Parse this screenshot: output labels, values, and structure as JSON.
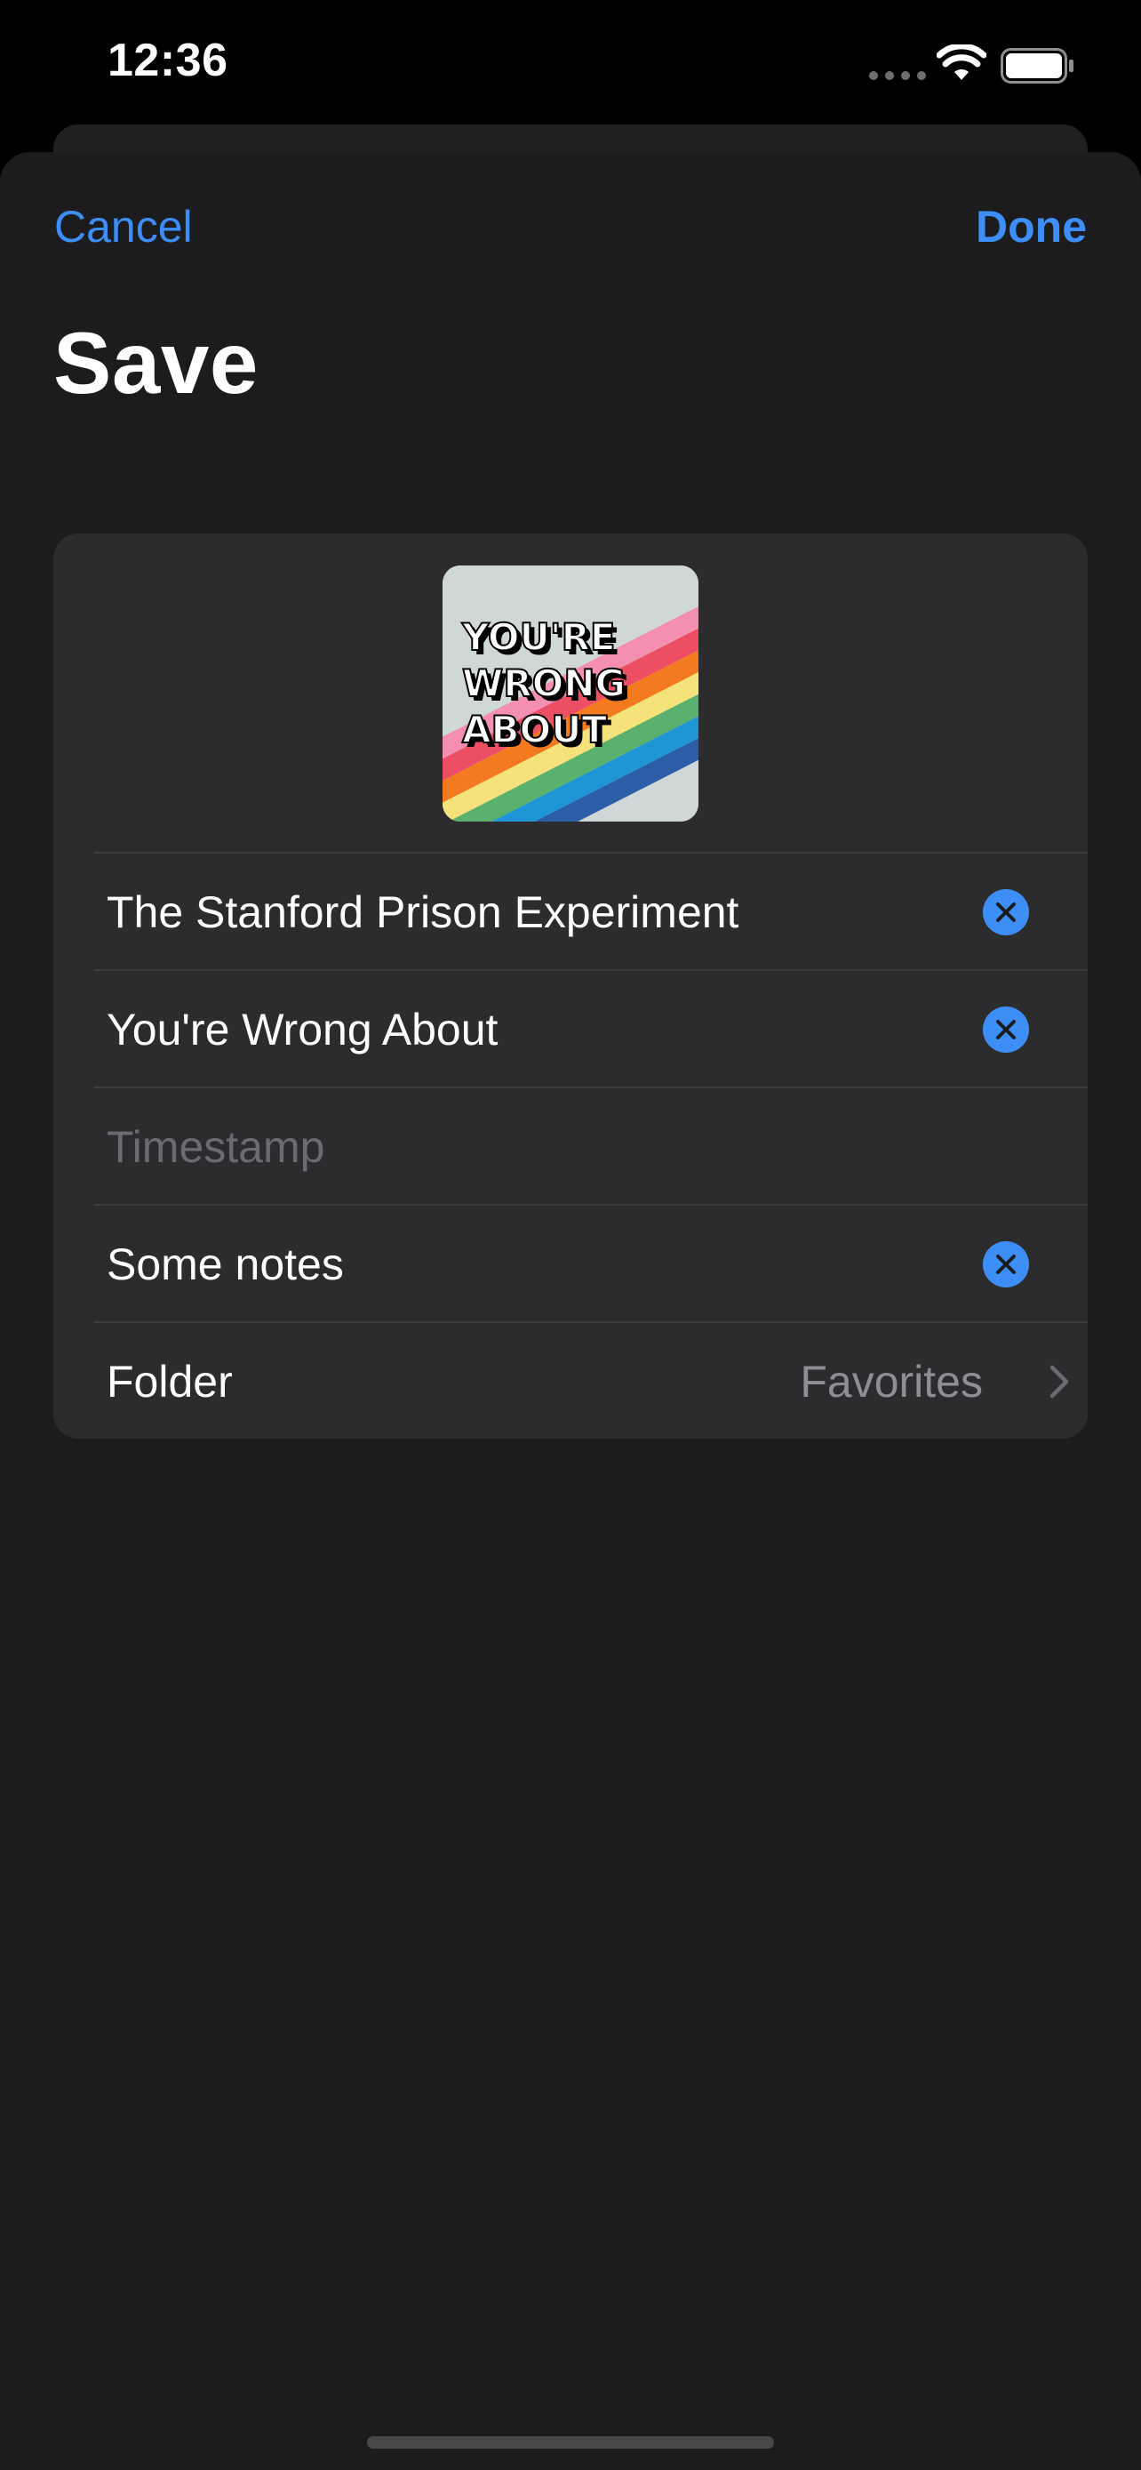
{
  "status_bar": {
    "time": "12:36",
    "signal_icon": "cellular-signal-icon",
    "wifi_icon": "wifi-icon",
    "battery_icon": "battery-icon"
  },
  "nav": {
    "cancel_label": "Cancel",
    "done_label": "Done",
    "title": "Save"
  },
  "artwork": {
    "icon": "podcast-artwork",
    "text_lines": [
      "YOU'RE",
      "WRONG",
      "ABOUT"
    ]
  },
  "form": {
    "episode_title": "The Stanford Prison Experiment",
    "podcast_name": "You're Wrong About",
    "timestamp_placeholder": "Timestamp",
    "notes": "Some notes",
    "folder_label": "Folder",
    "folder_value": "Favorites"
  },
  "colors": {
    "accent": "#3e8ef7",
    "sheet_background": "#1c1c1e",
    "card_background": "#2c2c2e",
    "secondary_text": "#8e8e93",
    "placeholder_text": "#6b6b70"
  }
}
